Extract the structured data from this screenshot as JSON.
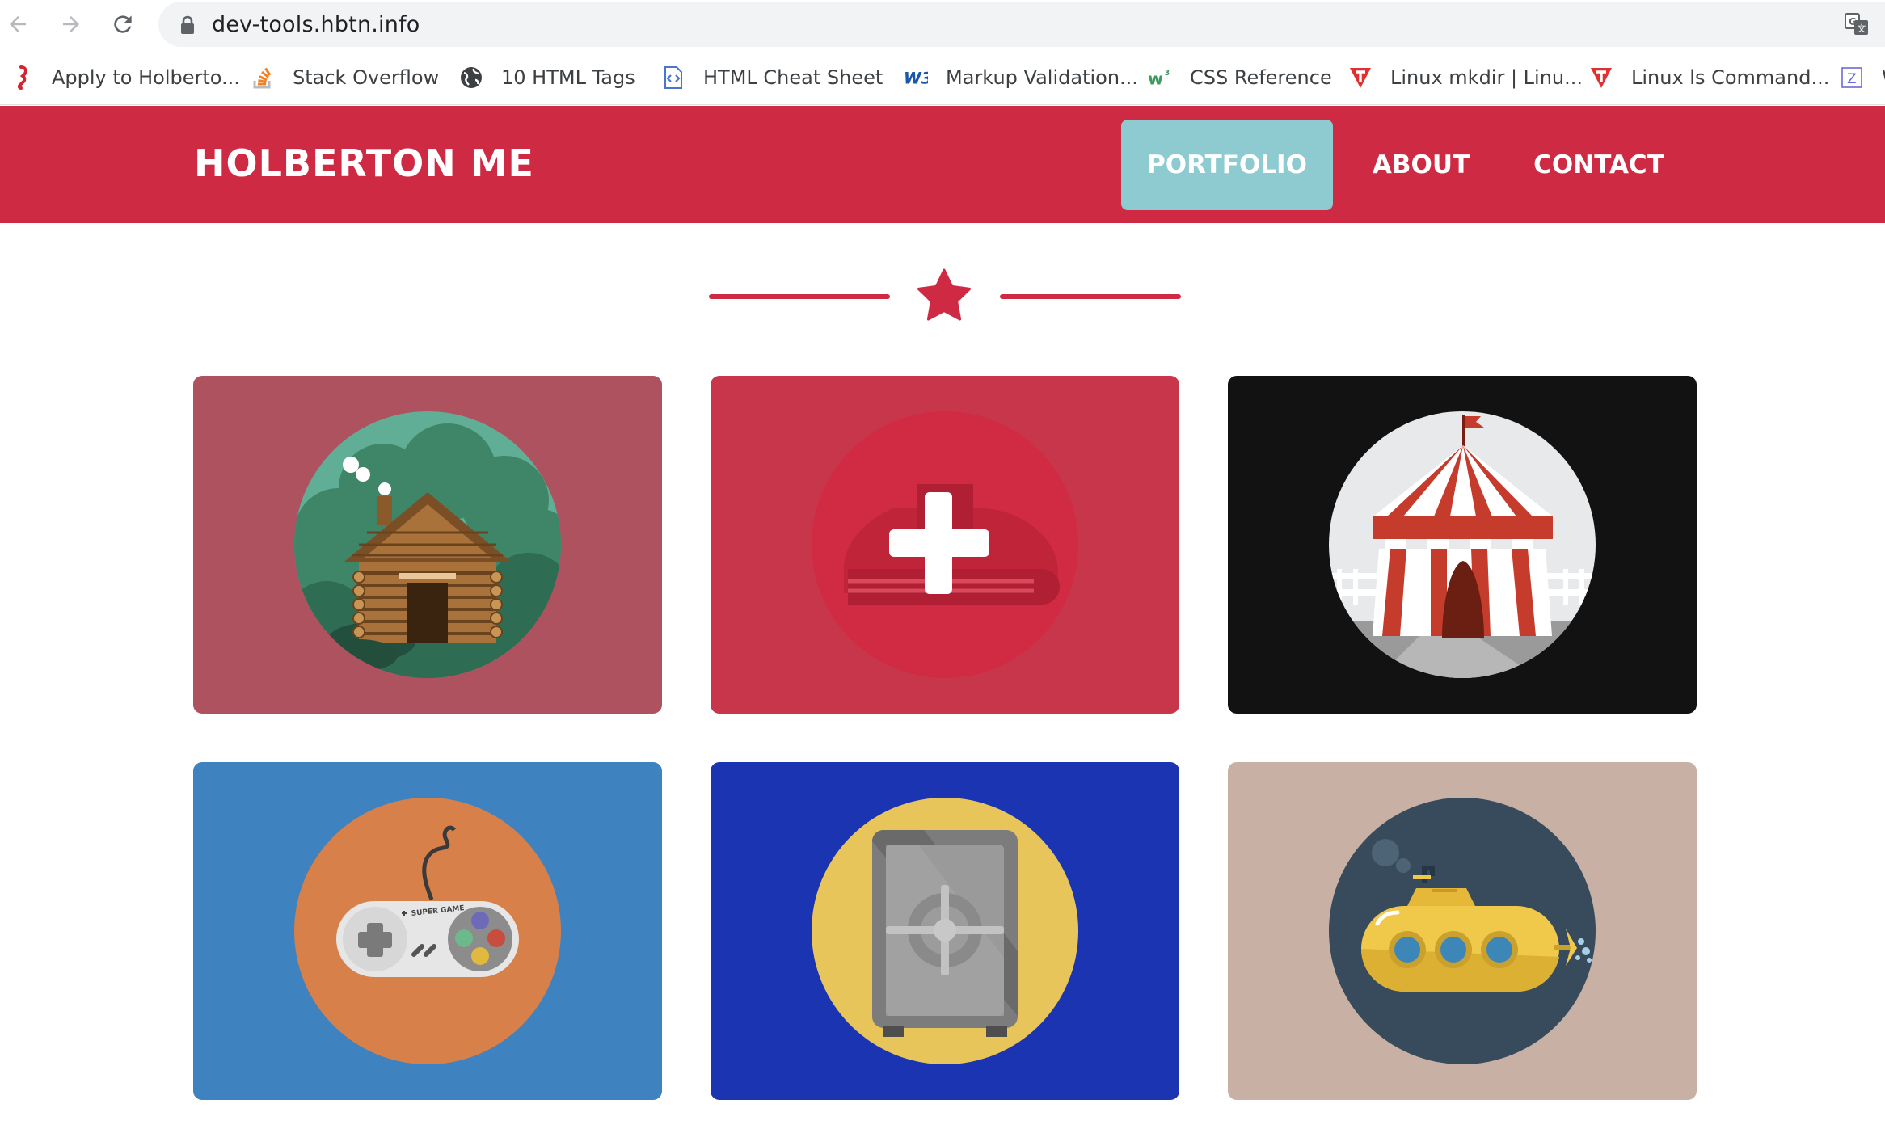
{
  "browser": {
    "url": "dev-tools.hbtn.info",
    "bookmarks": [
      {
        "label": "Apply to Holberto...",
        "icon": "holberton-seahorse-icon"
      },
      {
        "label": "Stack Overflow",
        "icon": "stackoverflow-icon"
      },
      {
        "label": "10 HTML Tags",
        "icon": "globe-icon"
      },
      {
        "label": "HTML Cheat Sheet",
        "icon": "code-doc-icon"
      },
      {
        "label": "Markup Validation...",
        "icon": "w3c-icon"
      },
      {
        "label": "CSS Reference",
        "icon": "w3schools-icon"
      },
      {
        "label": "Linux mkdir | Linu...",
        "icon": "tutorialspoint-icon"
      },
      {
        "label": "Linux ls Command...",
        "icon": "tutorialspoint-icon"
      },
      {
        "label": "W",
        "icon": "z-icon"
      }
    ]
  },
  "site": {
    "logo": "HOLBERTON ME",
    "nav": [
      {
        "label": "PORTFOLIO",
        "active": true
      },
      {
        "label": "ABOUT",
        "active": false
      },
      {
        "label": "CONTACT",
        "active": false
      }
    ]
  },
  "portfolio": [
    {
      "name": "log-cabin",
      "bg": "#ae5260",
      "circle": "#5da68f"
    },
    {
      "name": "first-aid",
      "bg": "#c8364c",
      "circle": "#d12a43"
    },
    {
      "name": "circus-tent",
      "bg": "#121212",
      "circle": "#e8e9ea"
    },
    {
      "name": "game-controller",
      "bg": "#3e82bf",
      "circle": "#d8804a"
    },
    {
      "name": "safe",
      "bg": "#1b35b2",
      "circle": "#e8c55a"
    },
    {
      "name": "submarine",
      "bg": "#c8b1a4",
      "circle": "#374b5c"
    }
  ],
  "colors": {
    "brand_red": "#cf2a44",
    "active_nav": "#8ecbd1"
  }
}
